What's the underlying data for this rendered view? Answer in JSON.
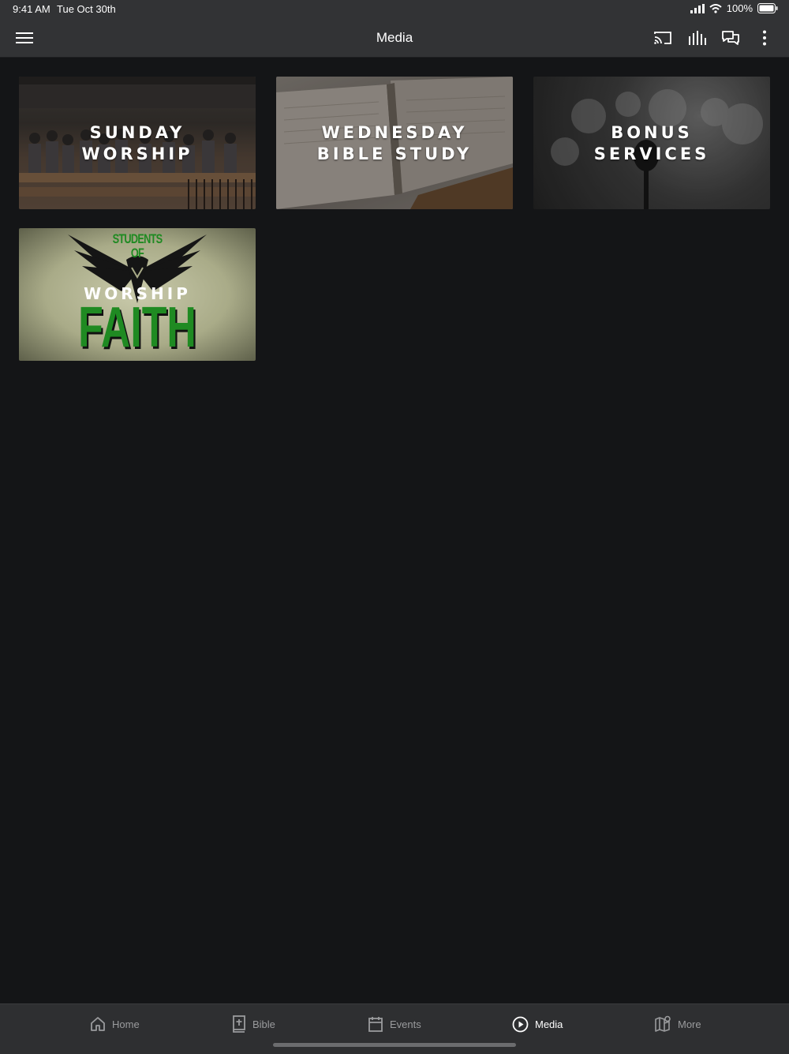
{
  "status": {
    "time": "9:41 AM",
    "date": "Tue Oct 30th",
    "battery": "100%"
  },
  "appbar": {
    "title": "Media"
  },
  "tiles": [
    {
      "line1": "SUNDAY",
      "line2": "WORSHIP"
    },
    {
      "line1": "WEDNESDAY",
      "line2": "BIBLE STUDY"
    },
    {
      "line1": "BONUS",
      "line2": "SERVICES"
    },
    {
      "line1": "STUDENTS",
      "line1b": "OF",
      "line2": "WORSHIP",
      "line3": "FAITH"
    }
  ],
  "tabs": [
    {
      "label": "Home",
      "icon": "home-icon"
    },
    {
      "label": "Bible",
      "icon": "bible-icon"
    },
    {
      "label": "Events",
      "icon": "calendar-icon"
    },
    {
      "label": "Media",
      "icon": "play-circle-icon",
      "active": true
    },
    {
      "label": "More",
      "icon": "map-icon"
    }
  ],
  "colors": {
    "background": "#141517",
    "bar": "#323335",
    "active": "#ffffff",
    "inactive": "#9a9b9d",
    "faith_green": "#1f8a22"
  }
}
